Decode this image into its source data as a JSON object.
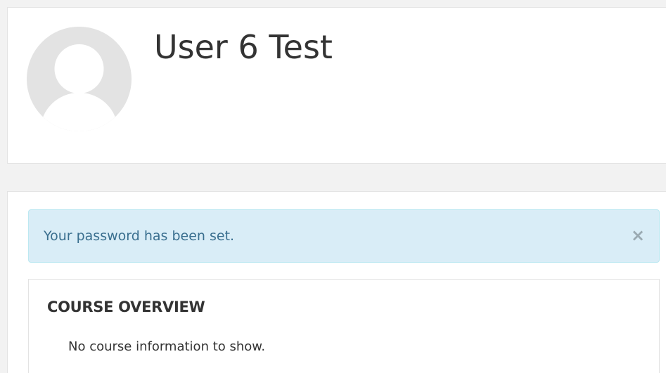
{
  "profile": {
    "name": "User 6 Test",
    "avatar_icon": "default-user-silhouette-icon"
  },
  "alert": {
    "message": "Your password has been set.",
    "close_label": "×",
    "close_icon": "close-icon"
  },
  "course_overview": {
    "title": "COURSE OVERVIEW",
    "empty_message": "No course information to show."
  },
  "colors": {
    "page_background": "#f2f2f2",
    "card_background": "#ffffff",
    "avatar_background": "#e3e3e3",
    "avatar_silhouette": "#ffffff",
    "alert_background": "#d9edf7",
    "alert_border": "#bce8f1",
    "alert_text": "#3a6f8f"
  }
}
